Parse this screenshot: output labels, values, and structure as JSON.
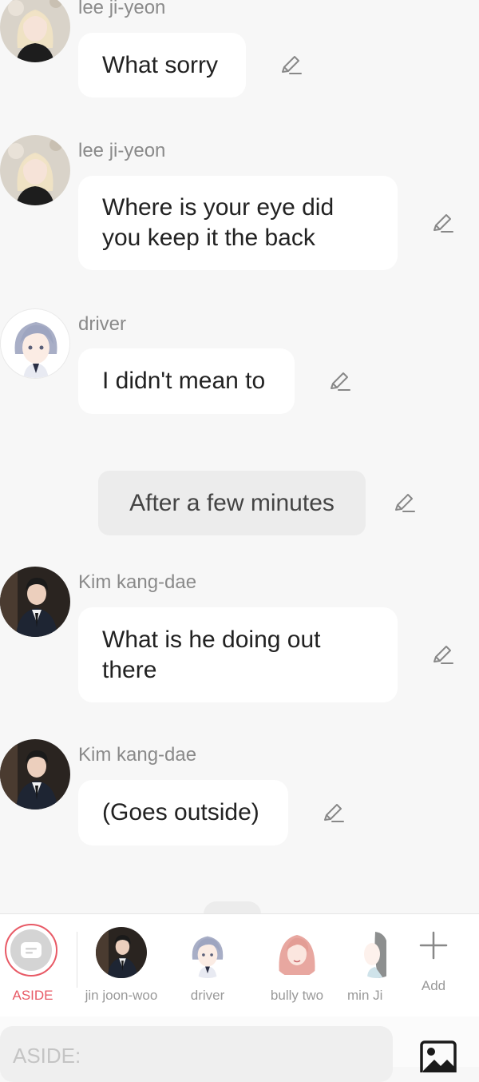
{
  "messages": [
    {
      "speaker": "lee ji-yeon",
      "text": "What sorry"
    },
    {
      "speaker": "lee ji-yeon",
      "text": "Where is your eye did you keep it the back"
    },
    {
      "speaker": "driver",
      "text": "I didn't mean to"
    },
    {
      "speaker": "Kim kang-dae",
      "text": "What is he doing out there"
    },
    {
      "speaker": "Kim kang-dae",
      "text": "(Goes outside)"
    }
  ],
  "narration": {
    "text": "After a few minutes"
  },
  "character_bar": {
    "aside_label": "ASIDE",
    "characters": [
      {
        "label": "jin joon-woo"
      },
      {
        "label": "driver"
      },
      {
        "label": "bully two"
      },
      {
        "label": "min Ji"
      }
    ],
    "add_label": "Add"
  },
  "input": {
    "placeholder": "ASIDE:"
  },
  "colors": {
    "accent": "#e85a66",
    "bubble": "#ffffff",
    "background": "#f7f7f7",
    "narration": "#ececec"
  }
}
